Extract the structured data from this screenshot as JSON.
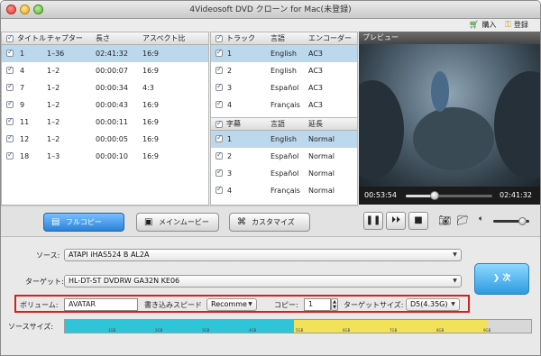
{
  "window": {
    "title": "4Videosoft DVD クローン for Mac(未登録)"
  },
  "toolbar": {
    "buy_label": "購入",
    "register_label": "登録"
  },
  "titles_table": {
    "headers": [
      "タイトル",
      "チャプター",
      "長さ",
      "アスペクト比"
    ],
    "rows": [
      {
        "title": "1",
        "chapter": "1–36",
        "length": "02:41:32",
        "aspect": "16:9",
        "selected": true
      },
      {
        "title": "4",
        "chapter": "1–2",
        "length": "00:00:07",
        "aspect": "16:9",
        "selected": false
      },
      {
        "title": "7",
        "chapter": "1–2",
        "length": "00:00:34",
        "aspect": "4:3",
        "selected": false
      },
      {
        "title": "9",
        "chapter": "1–2",
        "length": "00:00:43",
        "aspect": "16:9",
        "selected": false
      },
      {
        "title": "11",
        "chapter": "1–2",
        "length": "00:00:11",
        "aspect": "16:9",
        "selected": false
      },
      {
        "title": "12",
        "chapter": "1–2",
        "length": "00:00:05",
        "aspect": "16:9",
        "selected": false
      },
      {
        "title": "18",
        "chapter": "1–3",
        "length": "00:00:10",
        "aspect": "16:9",
        "selected": false
      }
    ]
  },
  "audio_table": {
    "headers": [
      "トラック",
      "言語",
      "エンコーダー"
    ],
    "rows": [
      {
        "track": "1",
        "lang": "English",
        "encoder": "AC3",
        "selected": true
      },
      {
        "track": "2",
        "lang": "English",
        "encoder": "AC3",
        "selected": false
      },
      {
        "track": "3",
        "lang": "Español",
        "encoder": "AC3",
        "selected": false
      },
      {
        "track": "4",
        "lang": "Français",
        "encoder": "AC3",
        "selected": false
      }
    ]
  },
  "subtitle_table": {
    "headers": [
      "字幕",
      "言語",
      "延長"
    ],
    "rows": [
      {
        "track": "1",
        "lang": "English",
        "ext": "Normal",
        "selected": true
      },
      {
        "track": "2",
        "lang": "Español",
        "ext": "Normal",
        "selected": false
      },
      {
        "track": "3",
        "lang": "Español",
        "ext": "Normal",
        "selected": false
      },
      {
        "track": "4",
        "lang": "Français",
        "ext": "Normal",
        "selected": false
      }
    ]
  },
  "preview": {
    "header": "プレビュー",
    "current_time": "00:53:54",
    "total_time": "02:41:32",
    "progress": 0.33,
    "volume": 0.8
  },
  "modes": {
    "full_copy": "フルコピー",
    "main_movie": "メインムービー",
    "customize": "カスタマイズ"
  },
  "source": {
    "label": "ソース:",
    "value": "ATAPI iHAS524   B AL2A"
  },
  "target": {
    "label": "ターゲット:",
    "value": "HL-DT-ST DVDRW  GA32N KE06"
  },
  "next_label": "次",
  "volume_label": {
    "label": "ボリューム:",
    "value": "AVATAR"
  },
  "write_speed": {
    "label": "書き込みスピード",
    "value": "Recomme"
  },
  "copies": {
    "label": "コピー:",
    "value": "1"
  },
  "target_size": {
    "label": "ターゲットサイズ:",
    "value": "D5(4.35G)"
  },
  "source_size": {
    "label": "ソースサイズ:",
    "ticks": [
      "1GB",
      "2GB",
      "3GB",
      "4GB",
      "5GB",
      "6GB",
      "7GB",
      "8GB",
      "9GB"
    ],
    "colors": {
      "used": "#2fc5d8",
      "over": "#f2e25a",
      "rest": "#d8d8d8"
    }
  }
}
